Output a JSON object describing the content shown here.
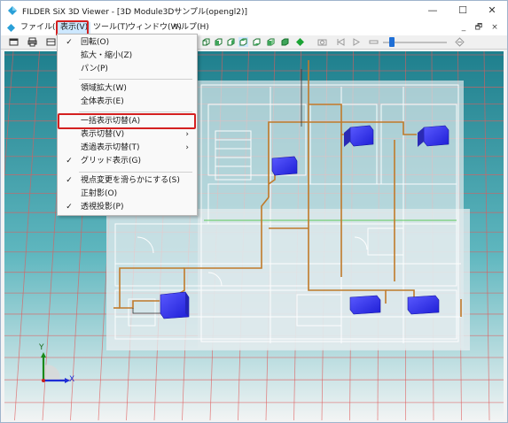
{
  "window": {
    "title": "FILDER SiX 3D Viewer - [3D Module3Dサンプル(opengl2)]",
    "minimize_glyph": "—",
    "maximize_glyph": "☐",
    "close_glyph": "✕"
  },
  "menubar": {
    "items": [
      {
        "label": "ファイル(F)",
        "icon": "app-doc-icon"
      },
      {
        "label": "表示(V)",
        "active": true
      },
      {
        "label": "ツール(T)"
      },
      {
        "label": "ウィンドウ(W)"
      },
      {
        "label": "ヘルプ(H)"
      }
    ],
    "mdi_minimize": "_",
    "mdi_restore": "🗗",
    "mdi_close": "×"
  },
  "view_menu": {
    "items": [
      {
        "label": "回転(O)",
        "checked": true
      },
      {
        "label": "拡大・縮小(Z)",
        "checked": false
      },
      {
        "label": "パン(P)",
        "checked": false
      },
      {
        "label": "領域拡大(W)",
        "checked": false
      },
      {
        "label": "全体表示(E)",
        "checked": false
      },
      {
        "label": "一括表示切替(A)",
        "checked": false,
        "highlighted": true
      },
      {
        "label": "表示切替(V)",
        "checked": false,
        "submenu": true
      },
      {
        "label": "透過表示切替(T)",
        "checked": false,
        "submenu": true
      },
      {
        "label": "グリッド表示(G)",
        "checked": true
      },
      {
        "label": "視点変更を滑らかにする(S)",
        "checked": true
      },
      {
        "label": "正射影(O)",
        "checked": false
      },
      {
        "label": "透視投影(P)",
        "checked": true
      }
    ],
    "check_glyph": "✓",
    "submenu_glyph": "›"
  },
  "viewport": {
    "background_color": "#2a8f98",
    "grid_color": "#e05c5c",
    "axes": {
      "x_label": "X",
      "y_label": "Y"
    },
    "unit_color": "#3b3bf0"
  },
  "icons": [
    "app-logo-icon",
    "print-icon",
    "open-icon",
    "view-cube-icon",
    "green-diamond-icon",
    "camera-icon",
    "first-frame-icon",
    "play-icon",
    "slider-icon",
    "zoom-icon"
  ]
}
